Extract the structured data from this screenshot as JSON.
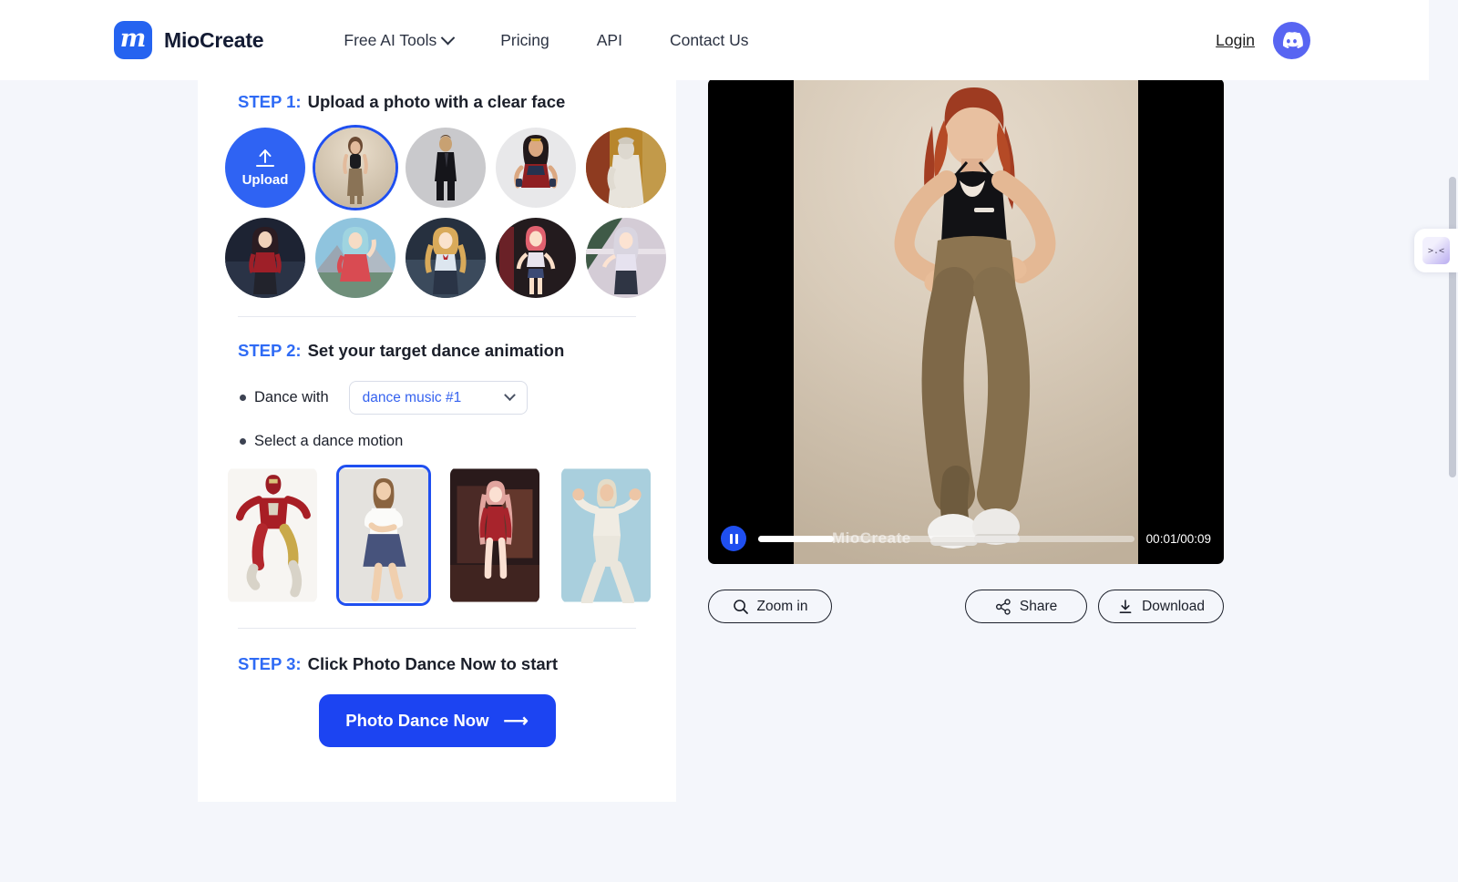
{
  "header": {
    "brand": {
      "logo_glyph": "m",
      "name": "MioCreate"
    },
    "nav": [
      {
        "label": "Free AI Tools",
        "has_dropdown": true
      },
      {
        "label": "Pricing",
        "has_dropdown": false
      },
      {
        "label": "API",
        "has_dropdown": false
      },
      {
        "label": "Contact Us",
        "has_dropdown": false
      }
    ],
    "login_label": "Login",
    "discord_icon": "discord-icon"
  },
  "steps": {
    "step1": {
      "num": "STEP 1:",
      "text": "Upload a photo with a clear face"
    },
    "step2": {
      "num": "STEP 2:",
      "text": "Set your target dance animation"
    },
    "step3": {
      "num": "STEP 3:",
      "text": "Click Photo Dance Now to start"
    }
  },
  "upload": {
    "label": "Upload",
    "icon": "upload-arrow-icon"
  },
  "avatars": [
    {
      "id": "avatar-woman-brown-leggings",
      "selected": true
    },
    {
      "id": "avatar-man-black-suit",
      "selected": false
    },
    {
      "id": "avatar-wonder-woman",
      "selected": false
    },
    {
      "id": "avatar-marble-statue",
      "selected": false
    },
    {
      "id": "avatar-anime-red-sweater",
      "selected": false
    },
    {
      "id": "avatar-anime-red-dress-mountain",
      "selected": false
    },
    {
      "id": "avatar-anime-blonde-twintails",
      "selected": false
    },
    {
      "id": "avatar-anime-pink-hair-shorts",
      "selected": false
    },
    {
      "id": "avatar-anime-silver-hair-uniform",
      "selected": false
    }
  ],
  "dance_with": {
    "bullet_label": "Dance with",
    "selected_option": "dance music #1",
    "chevron": "chevron-down-icon"
  },
  "dance_motion": {
    "bullet_label": "Select a dance motion",
    "items": [
      {
        "id": "motion-iron-man",
        "selected": false
      },
      {
        "id": "motion-woman-blue-skirt",
        "selected": true
      },
      {
        "id": "motion-anime-red-dress",
        "selected": false
      },
      {
        "id": "motion-blonde-white-suit",
        "selected": false
      }
    ]
  },
  "cta": {
    "label": "Photo Dance Now",
    "arrow": "⟶"
  },
  "player": {
    "watermark": "MioCreate",
    "time": "00:01/00:09",
    "progress_percent": 20,
    "play_state_icon": "pause-icon"
  },
  "actions": [
    {
      "id": "zoom-in-button",
      "label": "Zoom in",
      "icon": "magnifier-icon"
    },
    {
      "id": "share-button",
      "label": "Share",
      "icon": "share-nodes-icon"
    },
    {
      "id": "download-button",
      "label": "Download",
      "icon": "download-arrow-icon"
    }
  ],
  "floating_widget": {
    "icon": "kaomoji-face-icon",
    "face": ">.<"
  },
  "colors": {
    "accent_blue": "#1c44f2",
    "link_blue": "#2f6bf5",
    "page_bg": "#f4f6fb",
    "panel_bg": "#ffffff",
    "discord_purple": "#5865f2"
  }
}
